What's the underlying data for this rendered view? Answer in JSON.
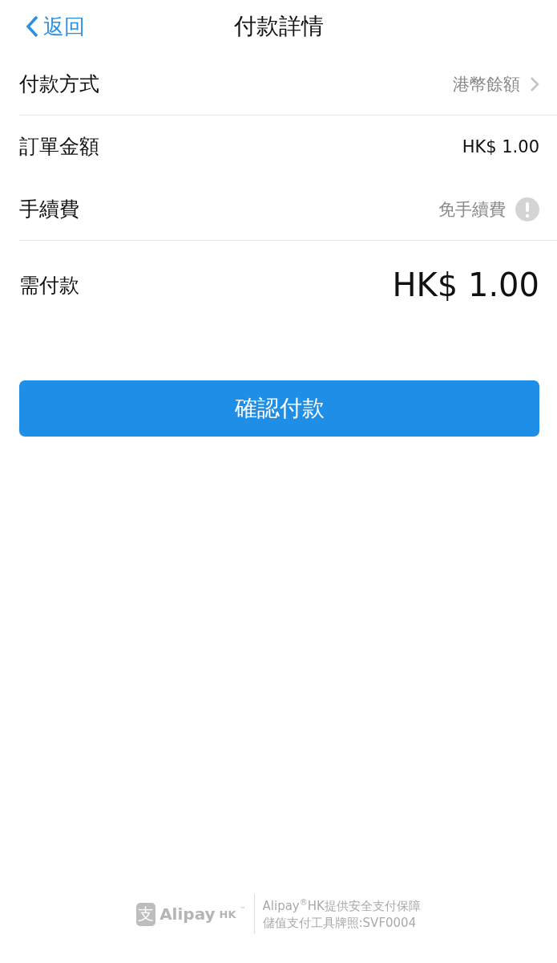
{
  "nav": {
    "back": "返回",
    "title": "付款詳情"
  },
  "rows": [
    {
      "label": "付款方式",
      "value": "港幣餘額",
      "kind": "link",
      "divider": true
    },
    {
      "label": "訂單金額",
      "value": "HK$ 1.00",
      "kind": "plain",
      "divider": false
    },
    {
      "label": "手續費",
      "value": "免手續費",
      "kind": "info",
      "divider": true
    }
  ],
  "total": {
    "label": "需付款",
    "amount": "HK$ 1.00"
  },
  "confirm_button": "確認付款",
  "footer": {
    "logo_glyph": "支",
    "logo_name": "Alipay",
    "logo_region": "HK",
    "logo_tm": "™",
    "lines": [
      "Alipay$^{®}$HK提供安全支付保障",
      "儲值支付工具牌照:SVF0004"
    ]
  }
}
